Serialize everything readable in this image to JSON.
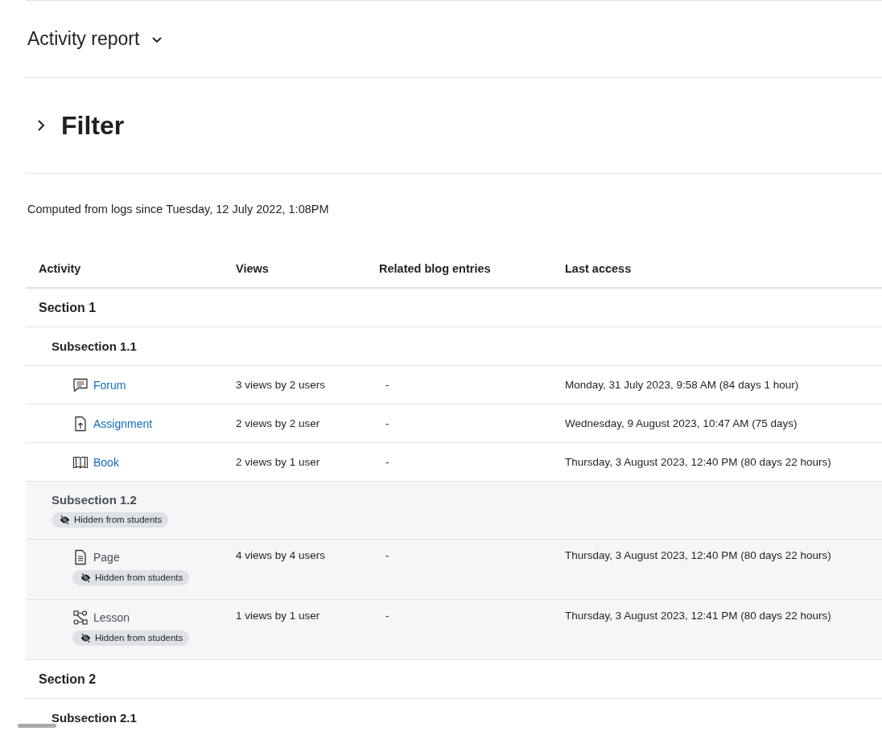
{
  "header": {
    "title": "Activity report"
  },
  "filter": {
    "title": "Filter",
    "expanded": false
  },
  "computed_note": "Computed from logs since Tuesday, 12 July 2022, 1:08PM",
  "table": {
    "columns": [
      "Activity",
      "Views",
      "Related blog entries",
      "Last access"
    ],
    "sections": [
      {
        "name": "Section 1",
        "hidden": false,
        "children": [
          {
            "name": "Subsection 1.1",
            "hidden": false,
            "children": [
              {
                "kind": "forum",
                "name": "Forum",
                "hidden": false,
                "views": "3 views by 2 users",
                "blog": "-",
                "last_access": "Monday, 31 July 2023, 9:58 AM (84 days 1 hour)"
              },
              {
                "kind": "assignment",
                "name": "Assignment",
                "hidden": false,
                "views": "2 views by 2 user",
                "blog": "-",
                "last_access": "Wednesday, 9 August 2023, 10:47 AM (75 days)"
              },
              {
                "kind": "book",
                "name": "Book",
                "hidden": false,
                "views": "2 views by 1 user",
                "blog": "-",
                "last_access": "Thursday, 3 August 2023, 12:40 PM (80 days 22 hours)"
              }
            ]
          },
          {
            "name": "Subsection 1.2",
            "hidden": true,
            "badge": "Hidden from students",
            "children": [
              {
                "kind": "page",
                "name": "Page",
                "hidden": true,
                "badge": "Hidden from students",
                "views": "4 views by 4 users",
                "blog": "-",
                "last_access": "Thursday, 3 August 2023, 12:40 PM (80 days 22 hours)"
              },
              {
                "kind": "lesson",
                "name": "Lesson",
                "hidden": true,
                "badge": "Hidden from students",
                "views": "1 views by 1 user",
                "blog": "-",
                "last_access": "Thursday, 3 August 2023, 12:41 PM (80 days 22 hours)"
              }
            ]
          }
        ]
      },
      {
        "name": "Section 2",
        "hidden": false,
        "children": [
          {
            "name": "Subsection 2.1",
            "hidden": false
          }
        ]
      }
    ]
  }
}
